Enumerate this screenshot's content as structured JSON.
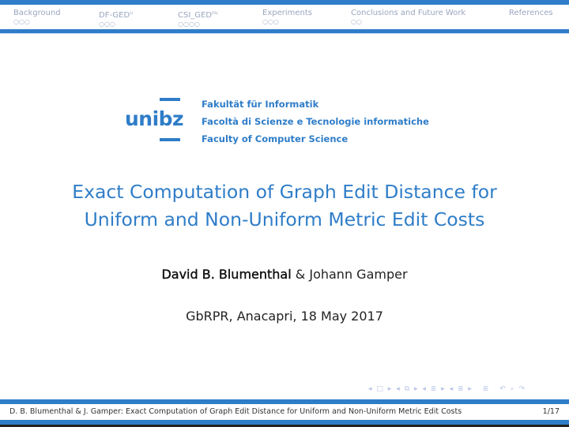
{
  "nav": {
    "sections": [
      {
        "label": "Background",
        "sup": "",
        "dots": "○○○"
      },
      {
        "label": "DF-GED",
        "sup": "u",
        "dots": "○○○"
      },
      {
        "label": "CSI_GED",
        "sup": "nu",
        "dots": "○○○○"
      },
      {
        "label": "Experiments",
        "sup": "",
        "dots": "○○○"
      },
      {
        "label": "Conclusions and Future Work",
        "sup": "",
        "dots": "○○"
      },
      {
        "label": "References",
        "sup": "",
        "dots": ""
      }
    ]
  },
  "logo": {
    "word": "unibz",
    "faculty_lines": [
      "Fakultät für Informatik",
      "Facoltà di Scienze e Tecnologie informatiche",
      "Faculty of Computer Science"
    ]
  },
  "title": {
    "line1": "Exact Computation of Graph Edit Distance for",
    "line2": "Uniform and Non-Uniform Metric Edit Costs"
  },
  "authors": {
    "first": "David B. Blumenthal",
    "sep": " & ",
    "second": "Johann Gamper"
  },
  "venue": "GbRPR, Anacapri, 18 May 2017",
  "beamer_nav": {
    "icons": [
      "◂",
      "□",
      "▸",
      "◂",
      "⧉",
      "▸",
      "◂",
      "≣",
      "▸",
      "◂",
      "≣",
      "▸",
      "≣",
      "↶",
      "⌕",
      "↷"
    ]
  },
  "footer": {
    "text": "D. B. Blumenthal & J. Gamper: Exact Computation of Graph Edit Distance for Uniform and Non-Uniform Metric Edit Costs",
    "page": "1/17"
  },
  "colors": {
    "accent": "#2f7dc8"
  }
}
